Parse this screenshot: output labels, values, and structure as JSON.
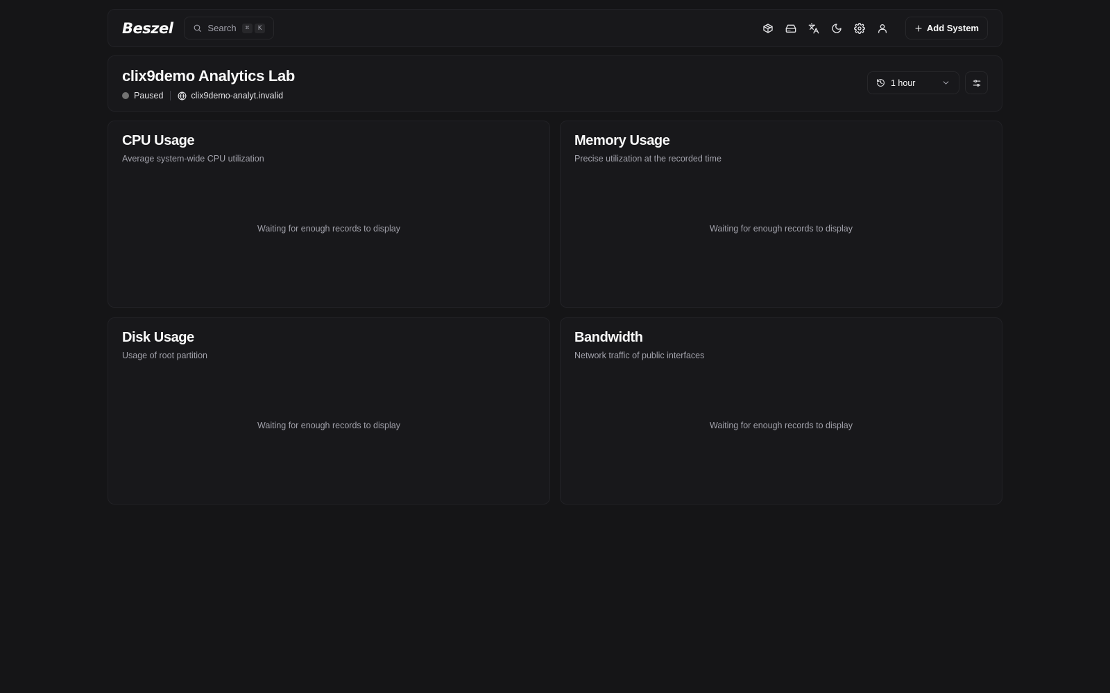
{
  "navbar": {
    "logo": "Beszel",
    "search": {
      "label": "Search",
      "shortcut": [
        "⌘",
        "K"
      ]
    },
    "icons": [
      "container-icon",
      "disk-icon",
      "translate-icon",
      "moon-icon",
      "gear-icon",
      "user-icon"
    ],
    "add_system_label": "Add System"
  },
  "system": {
    "name": "clix9demo Analytics Lab",
    "status": "Paused",
    "status_color": "#737373",
    "host": "clix9demo-analyt.invalid",
    "time_range": "1 hour"
  },
  "charts": [
    {
      "title": "CPU Usage",
      "description": "Average system-wide CPU utilization",
      "empty_text": "Waiting for enough records to display"
    },
    {
      "title": "Memory Usage",
      "description": "Precise utilization at the recorded time",
      "empty_text": "Waiting for enough records to display"
    },
    {
      "title": "Disk Usage",
      "description": "Usage of root partition",
      "empty_text": "Waiting for enough records to display"
    },
    {
      "title": "Bandwidth",
      "description": "Network traffic of public interfaces",
      "empty_text": "Waiting for enough records to display"
    }
  ]
}
